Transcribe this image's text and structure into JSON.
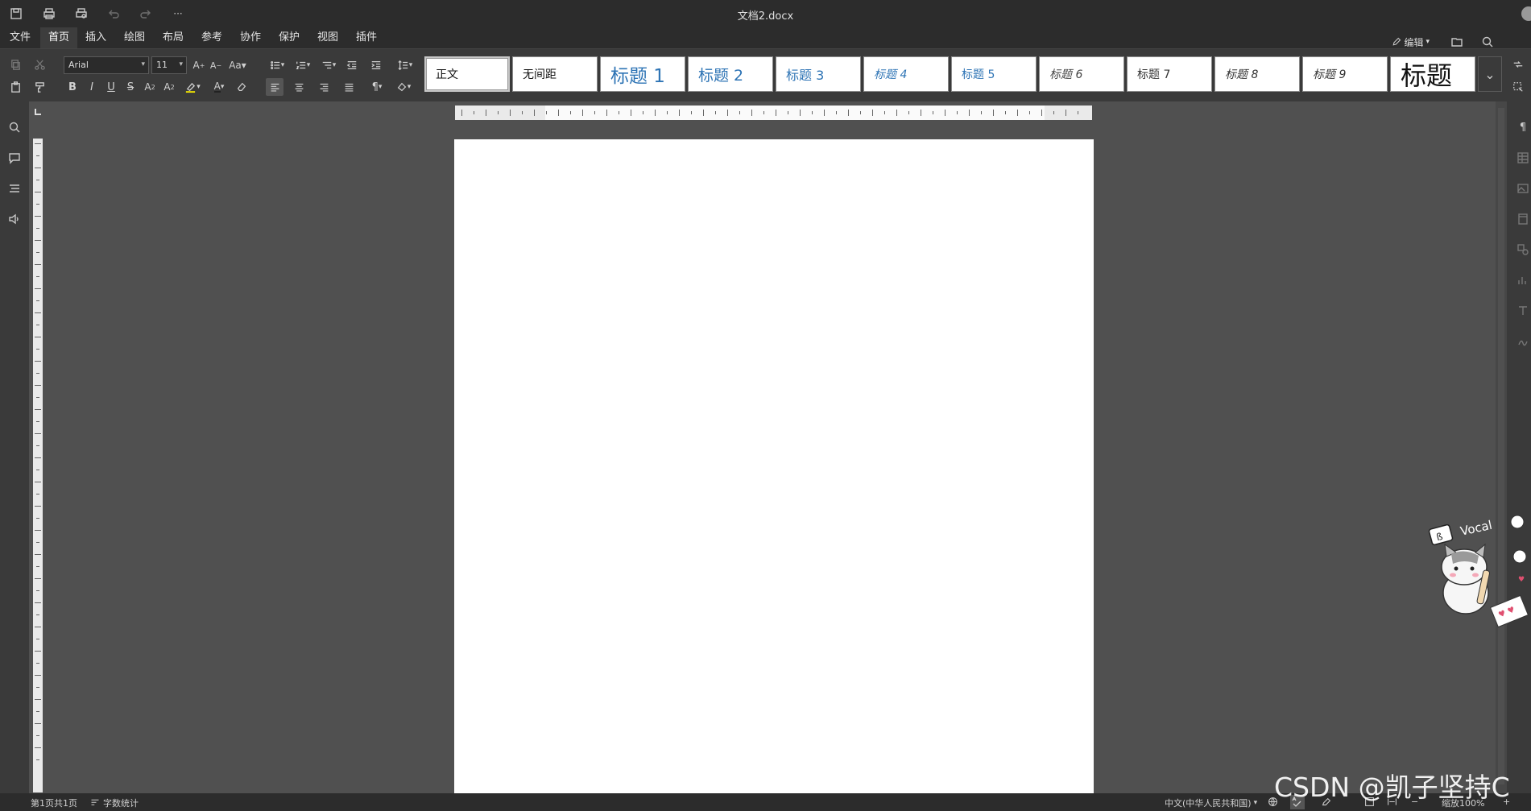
{
  "titlebar": {
    "document_name": "文档2.docx",
    "quick_access": [
      "save-icon",
      "print-icon",
      "print-preview-icon",
      "undo-icon",
      "redo-icon",
      "more-icon"
    ],
    "more_label": "···"
  },
  "menubar": {
    "items": [
      "文件",
      "首页",
      "插入",
      "绘图",
      "布局",
      "参考",
      "协作",
      "保护",
      "视图",
      "插件"
    ],
    "active": "首页",
    "edit_mode_label": "编辑"
  },
  "ribbon": {
    "font_name": "Arial",
    "font_size": "11",
    "styles": [
      "正文",
      "无间距",
      "标题 1",
      "标题 2",
      "标题 3",
      "标题 4",
      "标题 5",
      "标题 6",
      "标题 7",
      "标题 8",
      "标题 9",
      "标题"
    ],
    "selected_style": "正文"
  },
  "status": {
    "page_info": "第1页共1页",
    "word_count": "字数统计",
    "language": "中文(中华人民共和国)",
    "zoom": "缩放100%",
    "zoom_out": "−",
    "zoom_in": "+"
  },
  "watermark": "CSDN @凯子坚持C",
  "sticker_text": "Vocal",
  "colors": {
    "page": "#ffffff",
    "workspace": "#505050",
    "chrome": "#2c2c2c",
    "ribbon": "#3a3a3a",
    "heading_blue": "#2e74b5"
  }
}
